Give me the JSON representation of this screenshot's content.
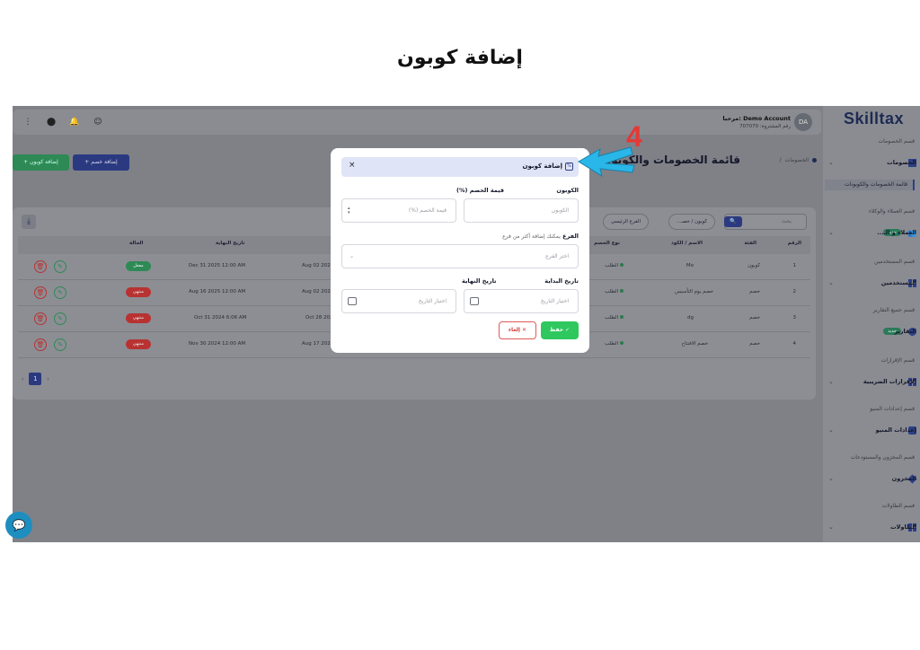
{
  "doc_title": "إضافة كوبون",
  "step_number": "4",
  "app": {
    "logo": "Skilltax",
    "user": {
      "avatar": "DA",
      "name": "Demo Account :مرحبا",
      "sub": "رقم المشتروة: 707070"
    }
  },
  "sidebar": {
    "sections": [
      {
        "title": "قسم الخصومات",
        "item": "الخصومات",
        "sub": "قائمة الخصومات والكوبونات"
      },
      {
        "title": "قسم العملاء والوكلاء",
        "item": "العملاء و الـ...",
        "badge": "جديد"
      },
      {
        "title": "قسم المستخدمين",
        "item": "المستخدمين"
      },
      {
        "title": "قسم جميع التقارير",
        "item": "التقارير",
        "badge": "جديد"
      },
      {
        "title": "قسم الإقرارات",
        "item": "الإقرارات الضريبية"
      },
      {
        "title": "قسم إعدادات المنيو",
        "item": "إعدادات المنيو"
      },
      {
        "title": "قسم المخزون والمستودعات",
        "item": "المخزون"
      },
      {
        "title": "قسم الطاولات",
        "item": "الطاولات"
      }
    ]
  },
  "page": {
    "breadcrumb_root": "الخصومات",
    "breadcrumb_sep": "/",
    "title": "قائمة الخصومات والكوبونات",
    "add_discount": "+ إضافة خصم",
    "add_coupon": "+ إضافة كوبون"
  },
  "filters": {
    "search_placeholder": "بحث",
    "type_filter": "كوبون / خصـ...",
    "branch_filter": "الفرع الرئيسي"
  },
  "table": {
    "headers": [
      "الرقم",
      "الفئة",
      "الاسم / الكود",
      "نوع الخصم",
      "تاريخ النهاية",
      "الحالة"
    ],
    "rows": [
      {
        "num": "1",
        "category": "كوبون",
        "name": "Mo",
        "type": "الطلب",
        "start": "Aug 02 2025 1",
        "end": "Dec 31 2025 12:00 AM",
        "status": "مفعل"
      },
      {
        "num": "2",
        "category": "خصم",
        "name": "خصم يوم التأسيس",
        "type": "الطلب",
        "start": "Aug 02 2025 1",
        "end": "Aug 16 2025 12:00 AM",
        "status": "منتهي"
      },
      {
        "num": "3",
        "category": "خصم",
        "name": "dg",
        "type": "الطلب",
        "start": "Oct 28 2024",
        "end": "Oct 31 2024 6:06 AM",
        "status": "منتهي"
      },
      {
        "num": "4",
        "category": "خصم",
        "name": "خصم الافتتاح",
        "type": "الطلب",
        "start": "Aug 17 2024 1",
        "end": "Nov 30 2024 12:00 AM",
        "status": "منتهي"
      }
    ],
    "page": "1"
  },
  "modal": {
    "title": "إضافة كوبون",
    "coupon_label": "الكوبون",
    "coupon_placeholder": "الكوبون",
    "discount_label": "قيمة الخصم (%)",
    "discount_placeholder": "قيمة الخصم (%)",
    "branch_label": "الفرع",
    "branch_hint": "يمكنك إضافة أكثر من فرع",
    "branch_placeholder": "اختر الفرع",
    "start_label": "تاريخ البداية",
    "start_placeholder": "اختيار التاريخ",
    "end_label": "تاريخ النهاية",
    "end_placeholder": "اختيار التاريخ",
    "save": "حفظ",
    "cancel": "إلغاء"
  },
  "colors": {
    "accent": "#2b3a80",
    "save": "#2fc85e",
    "cancel": "#d23c3c",
    "annotation": "#e53935",
    "arrow": "#29b6e8"
  }
}
